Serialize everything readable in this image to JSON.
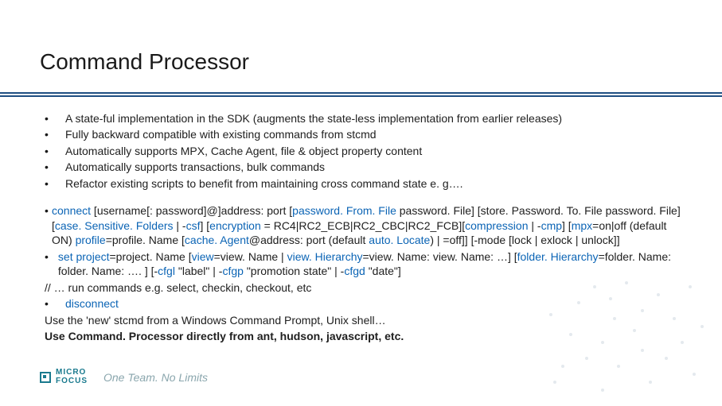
{
  "title": "Command Processor",
  "intro_bullets": [
    "A state-ful implementation in the SDK (augments the state-less implementation from earlier releases)",
    "Fully backward compatible with existing commands from stcmd",
    "Automatically supports MPX, Cache Agent, file & object property content",
    "Automatically supports transactions, bulk commands",
    "Refactor existing scripts to benefit from maintaining cross command state e. g…."
  ],
  "cmd_bullets": [
    {
      "segs": [
        {
          "kw": true,
          "t": "connect"
        },
        {
          "kw": false,
          "t": " [username[: password]@]address: port ["
        },
        {
          "kw": true,
          "t": "password. From. File"
        },
        {
          "kw": false,
          "t": " password. File] [store. Password. To. File password. File] ["
        },
        {
          "kw": true,
          "t": "case. Sensitive. Folders"
        },
        {
          "kw": false,
          "t": " | -"
        },
        {
          "kw": true,
          "t": "csf"
        },
        {
          "kw": false,
          "t": "] ["
        },
        {
          "kw": true,
          "t": "encryption"
        },
        {
          "kw": false,
          "t": " = RC4|RC2_ECB|RC2_CBC|RC2_FCB]["
        },
        {
          "kw": true,
          "t": "compression"
        },
        {
          "kw": false,
          "t": " | -"
        },
        {
          "kw": true,
          "t": "cmp"
        },
        {
          "kw": false,
          "t": "] ["
        },
        {
          "kw": true,
          "t": "mpx"
        },
        {
          "kw": false,
          "t": "=on|off (default ON) "
        },
        {
          "kw": true,
          "t": "profile"
        },
        {
          "kw": false,
          "t": "=profile. Name ["
        },
        {
          "kw": true,
          "t": "cache. Agent"
        },
        {
          "kw": false,
          "t": "@address: port (default "
        },
        {
          "kw": true,
          "t": "auto. Locate"
        },
        {
          "kw": false,
          "t": ") | =off]] [-mode [lock | exlock | unlock]]"
        }
      ]
    },
    {
      "segs": [
        {
          "kw": true,
          "t": "set project"
        },
        {
          "kw": false,
          "t": "=project. Name ["
        },
        {
          "kw": true,
          "t": "view"
        },
        {
          "kw": false,
          "t": "=view. Name | "
        },
        {
          "kw": true,
          "t": "view. Hierarchy"
        },
        {
          "kw": false,
          "t": "=view. Name: view. Name: …] ["
        },
        {
          "kw": true,
          "t": "folder. Hierarchy"
        },
        {
          "kw": false,
          "t": "=folder. Name: folder. Name: …. ] [-"
        },
        {
          "kw": true,
          "t": "cfgl"
        },
        {
          "kw": false,
          "t": " \"label\" | -"
        },
        {
          "kw": true,
          "t": "cfgp"
        },
        {
          "kw": false,
          "t": " \"promotion state\" | -"
        },
        {
          "kw": true,
          "t": "cfgd"
        },
        {
          "kw": false,
          "t": " \"date\"]"
        }
      ]
    }
  ],
  "run_line": "// … run commands e.g. select, checkin, checkout, etc",
  "disconnect_bullet": {
    "kw": true,
    "t": "disconnect"
  },
  "stcmd_line": "Use the 'new' stcmd from a Windows Command Prompt, Unix shell…",
  "bold_line": "Use Command. Processor directly from ant, hudson, javascript, etc.",
  "footer": {
    "logo_line1": "MICRO",
    "logo_line2": "FOCUS",
    "tagline": "One Team. No Limits"
  }
}
